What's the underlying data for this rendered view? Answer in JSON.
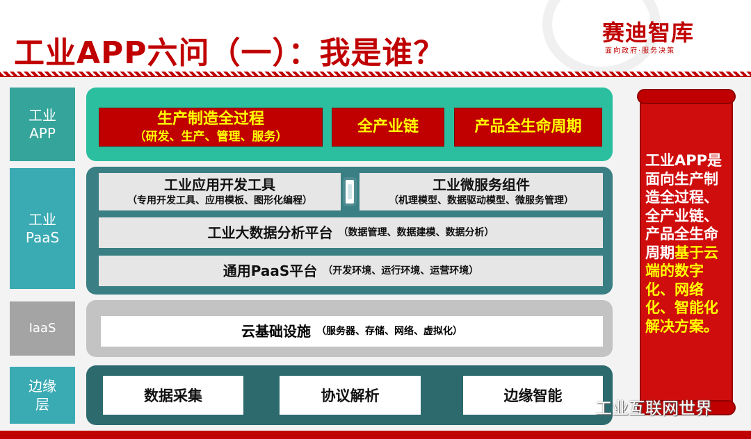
{
  "header": {
    "title": "工业APP六问（一）：我是谁？",
    "logo_name": "赛迪智库",
    "logo_slogan": "面向政府·服务决策"
  },
  "layers": {
    "app_label": "工业\nAPP",
    "paas_label": "工业\nPaaS",
    "iaas_label": "IaaS",
    "edge_label": "边缘\n层"
  },
  "app_layer": {
    "box1_title": "生产制造全过程",
    "box1_sub": "（研发、生产、管理、服务）",
    "box2_title": "全产业链",
    "box3_title": "产品全生命周期"
  },
  "paas_layer": {
    "tools_title": "工业应用开发工具",
    "tools_sub": "（专用开发工具、应用模板、图形化编程）",
    "micro_title": "工业微服务组件",
    "micro_sub": "（机理模型、数据驱动模型、微服务管理）",
    "bigdata_title": "工业大数据分析平台",
    "bigdata_sub": "（数据管理、数据建模、数据分析）",
    "general_title": "通用PaaS平台",
    "general_sub": "（开发环境、运行环境、运营环境）"
  },
  "iaas_layer": {
    "infra_title": "云基础设施",
    "infra_sub": "（服务器、存储、网络、虚拟化）"
  },
  "edge_layer": {
    "collect": "数据采集",
    "protocol": "协议解析",
    "intel": "边缘智能"
  },
  "scroll": {
    "text_white": "工业APP是面向生产制造全过程、全产业链、产品全生命周期",
    "text_yellow": "基于云端的数字化、网络化、智能化解决方案。"
  },
  "watermark": "工业互联网世界",
  "colors": {
    "brand_red": "#c00000",
    "highlight_yellow": "#ffff00",
    "teal": "#2bbf9f",
    "dark_teal": "#3a7f83"
  }
}
